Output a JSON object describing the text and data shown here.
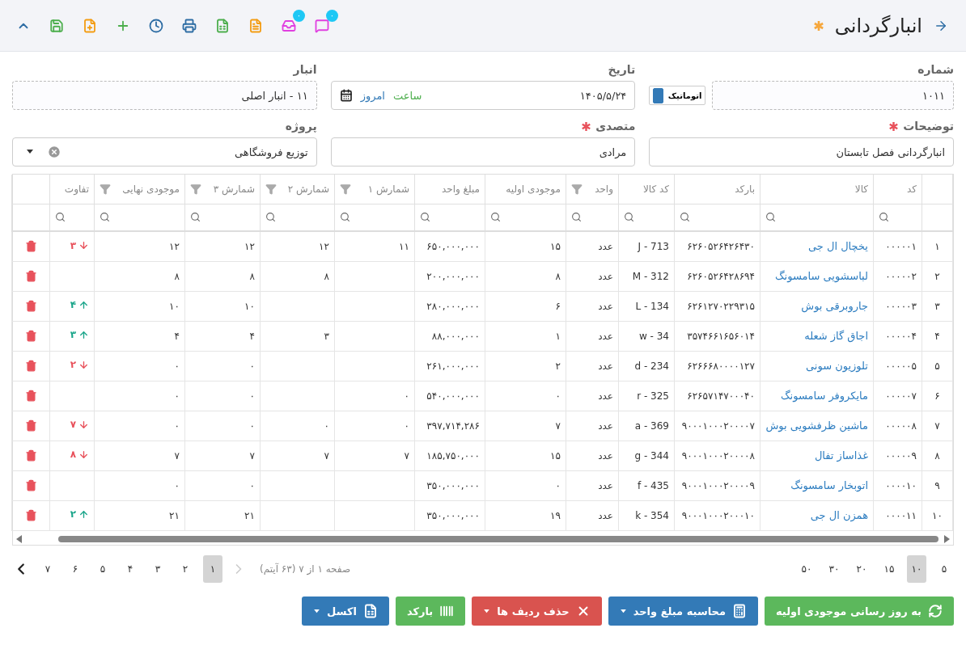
{
  "header": {
    "title": "انبارگردانی",
    "modified": true
  },
  "toolbar": [
    {
      "kind": "chat",
      "badge": "۰"
    },
    {
      "kind": "inbox",
      "badge": "۰"
    },
    {
      "kind": "pdf"
    },
    {
      "kind": "excel"
    },
    {
      "kind": "print"
    },
    {
      "kind": "history"
    },
    {
      "kind": "add"
    },
    {
      "kind": "new-file"
    },
    {
      "kind": "save"
    },
    {
      "kind": "collapse"
    }
  ],
  "form": {
    "number": {
      "label": "شماره",
      "required": false,
      "value": "۱۰۱۱",
      "readonly": true,
      "auto_label": "اتوماتیک",
      "auto": true
    },
    "date": {
      "label": "تاریخ",
      "required": false,
      "value": "۱۴۰۵/۵/۲۴",
      "readonly": false,
      "time_label": "ساعت",
      "today_label": "امروز"
    },
    "warehouse": {
      "label": "انبار",
      "required": false,
      "value": "۱۱ - انبار اصلی",
      "readonly": true
    },
    "description": {
      "label": "توضیحات",
      "required": true,
      "readonly": false,
      "value": "انبارگردانی فصل تابستان"
    },
    "operator": {
      "label": "متصدی",
      "required": true,
      "readonly": false,
      "value": "مرادی"
    },
    "project": {
      "label": "پروژه",
      "required": false,
      "readonly": false,
      "value": "توزیع فروشگاهی"
    }
  },
  "table": {
    "columns": [
      {
        "label": "کد",
        "filter": false
      },
      {
        "label": "کالا",
        "filter": false
      },
      {
        "label": "بارکد",
        "filter": false
      },
      {
        "label": "کد کالا",
        "filter": false
      },
      {
        "label": "واحد",
        "filter": true
      },
      {
        "label": "موجودی اولیه",
        "filter": false
      },
      {
        "label": "مبلغ واحد",
        "filter": false
      },
      {
        "label": "شمارش ۱",
        "filter": true
      },
      {
        "label": "شمارش ۲",
        "filter": true
      },
      {
        "label": "شمارش ۳",
        "filter": true
      },
      {
        "label": "موجودی نهایی",
        "filter": true
      },
      {
        "label": "تفاوت",
        "filter": false
      }
    ],
    "rows": [
      {
        "index": "۱",
        "code": "۰۰۰۰۰۱",
        "name": "یخچال ال جی",
        "barcode": "۶۲۶۰۵۲۶۴۲۶۴۳۰",
        "item_code": "J - 713",
        "unit": "عدد",
        "initial": "۱۵",
        "unit_price": "۶۵۰,۰۰۰,۰۰۰",
        "count_1": "۱۱",
        "count_2": "۱۲",
        "count_3": "۱۲",
        "final": "۱۲",
        "diff": {
          "value": "۳",
          "increase": false
        }
      },
      {
        "index": "۲",
        "code": "۰۰۰۰۰۲",
        "name": "لباسشویی سامسونگ",
        "barcode": "۶۲۶۰۵۲۶۴۲۸۶۹۴",
        "item_code": "M - 312",
        "unit": "عدد",
        "initial": "۸",
        "unit_price": "۲۰۰,۰۰۰,۰۰۰",
        "count_2": "۸",
        "count_3": "۸",
        "final": "۸"
      },
      {
        "index": "۳",
        "code": "۰۰۰۰۰۳",
        "name": "جاروبرقی بوش",
        "barcode": "۶۲۶۱۲۷۰۲۲۹۳۱۵",
        "item_code": "L - 134",
        "unit": "عدد",
        "initial": "۶",
        "unit_price": "۲۸۰,۰۰۰,۰۰۰",
        "count_3": "۱۰",
        "final": "۱۰",
        "diff": {
          "value": "۴",
          "increase": true
        }
      },
      {
        "index": "۴",
        "code": "۰۰۰۰۰۴",
        "name": "اجاق گاز شعله",
        "barcode": "۳۵۷۴۶۶۱۶۵۶۰۱۴",
        "item_code": "w - 34",
        "unit": "عدد",
        "initial": "۱",
        "unit_price": "۸۸,۰۰۰,۰۰۰",
        "count_2": "۳",
        "count_3": "۴",
        "final": "۴",
        "diff": {
          "value": "۳",
          "increase": true
        }
      },
      {
        "index": "۵",
        "code": "۰۰۰۰۰۵",
        "name": "تلوزیون سونی",
        "barcode": "۶۲۶۶۶۸۰۰۰۰۱۲۷",
        "item_code": "d - 234",
        "unit": "عدد",
        "initial": "۲",
        "unit_price": "۲۶۱,۰۰۰,۰۰۰",
        "count_3": "۰",
        "final": "۰",
        "diff": {
          "value": "۲",
          "increase": false
        }
      },
      {
        "index": "۶",
        "code": "۰۰۰۰۰۷",
        "name": "مایکروفر سامسونگ",
        "barcode": "۶۲۶۵۷۱۴۷۰۰۰۴۰",
        "item_code": "r - 325",
        "unit": "عدد",
        "initial": "۰",
        "unit_price": "۵۴۰,۰۰۰,۰۰۰",
        "count_1": "۰",
        "count_3": "۰",
        "final": "۰"
      },
      {
        "index": "۷",
        "code": "۰۰۰۰۰۸",
        "name": "ماشین ظرفشویی بوش",
        "barcode": "۹۰۰۰۱۰۰۰۲۰۰۰۰۷",
        "item_code": "a - 369",
        "unit": "عدد",
        "initial": "۷",
        "unit_price": "۳۹۷,۷۱۴,۲۸۶",
        "count_1": "۰",
        "count_2": "۰",
        "count_3": "۰",
        "final": "۰",
        "diff": {
          "value": "۷",
          "increase": false
        }
      },
      {
        "index": "۸",
        "code": "۰۰۰۰۰۹",
        "name": "غذاساز تفال",
        "barcode": "۹۰۰۰۱۰۰۰۲۰۰۰۰۸",
        "item_code": "g - 344",
        "unit": "عدد",
        "initial": "۱۵",
        "unit_price": "۱۸۵,۷۵۰,۰۰۰",
        "count_1": "۷",
        "count_2": "۷",
        "count_3": "۷",
        "final": "۷",
        "diff": {
          "value": "۸",
          "increase": false
        }
      },
      {
        "index": "۹",
        "code": "۰۰۰۰۱۰",
        "name": "اتوبخار سامسونگ",
        "barcode": "۹۰۰۰۱۰۰۰۲۰۰۰۰۹",
        "item_code": "f - 435",
        "unit": "عدد",
        "initial": "۰",
        "unit_price": "۳۵۰,۰۰۰,۰۰۰",
        "count_3": "۰",
        "final": "۰"
      },
      {
        "index": "۱۰",
        "code": "۰۰۰۰۱۱",
        "name": "همزن ال جی",
        "barcode": "۹۰۰۰۱۰۰۰۲۰۰۰۱۰",
        "item_code": "k - 354",
        "unit": "عدد",
        "initial": "۱۹",
        "unit_price": "۳۵۰,۰۰۰,۰۰۰",
        "count_3": "۲۱",
        "final": "۲۱",
        "diff": {
          "value": "۲",
          "increase": true
        }
      }
    ]
  },
  "pagination": {
    "page_sizes": [
      {
        "label": "۵",
        "selected": false
      },
      {
        "label": "۱۰",
        "selected": true
      },
      {
        "label": "۱۵",
        "selected": false
      },
      {
        "label": "۲۰",
        "selected": false
      },
      {
        "label": "۳۰",
        "selected": false
      },
      {
        "label": "۵۰",
        "selected": false
      }
    ],
    "info": "صفحه ۱ از ۷ (۶۳ آیتم)",
    "prev_disabled": true,
    "next_disabled": false,
    "pages": [
      {
        "label": "۱",
        "selected": true
      },
      {
        "label": "۲",
        "selected": false
      },
      {
        "label": "۳",
        "selected": false
      },
      {
        "label": "۴",
        "selected": false
      },
      {
        "label": "۵",
        "selected": false
      },
      {
        "label": "۶",
        "selected": false
      },
      {
        "label": "۷",
        "selected": false
      }
    ]
  },
  "actions": [
    {
      "label": "به روز رسانی موجودی اولیه",
      "kind": "refresh",
      "color": "#5cb85c",
      "dropdown": false
    },
    {
      "label": "محاسبه مبلغ واحد",
      "kind": "calculator",
      "color": "#337ab7",
      "dropdown": true
    },
    {
      "label": "حذف ردیف ها",
      "kind": "delete",
      "color": "#d9534f",
      "dropdown": true
    },
    {
      "label": "بارکد",
      "kind": "barcode",
      "color": "#5cb85c",
      "dropdown": false
    },
    {
      "label": "اکسل",
      "kind": "excel",
      "color": "#337ab7",
      "dropdown": true
    }
  ]
}
